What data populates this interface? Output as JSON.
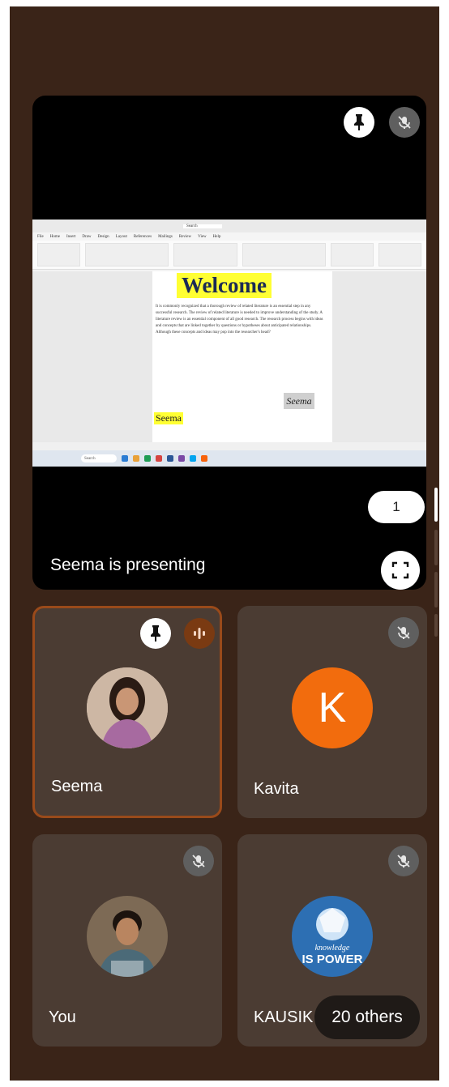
{
  "presentation": {
    "title": "Seema is presenting",
    "page_number": "1",
    "document": {
      "heading": "Welcome",
      "search_placeholder": "Search",
      "tabs": [
        "File",
        "Home",
        "Insert",
        "Draw",
        "Design",
        "Layout",
        "References",
        "Mailings",
        "Review",
        "View",
        "Help"
      ],
      "body": "It is commonly recognized that a thorough review of related literature is an essential step in any successful research. The review of related literature is needed to improve understanding of the study. A literature review is an essential component of all good research. The research process begins with ideas and concepts that are linked together by questions or hypotheses about anticipated relationships. Although these concepts and ideas may pop into the researcher's head?",
      "signature_box": "Seema",
      "signature_highlight": "Seema"
    }
  },
  "participants": [
    {
      "name": "Seema",
      "speaking": true,
      "pinned": true
    },
    {
      "name": "Kavita",
      "initial": "K",
      "muted": true
    },
    {
      "name": "You",
      "muted": true
    },
    {
      "name": "KAUSIK",
      "muted": true,
      "avatar_text_line1": "knowledge",
      "avatar_text_line2": "IS POWER"
    }
  ],
  "others_label": "20 others",
  "colors": {
    "screen_bg": "#3a2418",
    "tile_bg": "#4b3c33",
    "active_border": "#9a4a1a",
    "avatar_orange": "#f26c0d",
    "highlight_yellow": "#ffff33"
  }
}
